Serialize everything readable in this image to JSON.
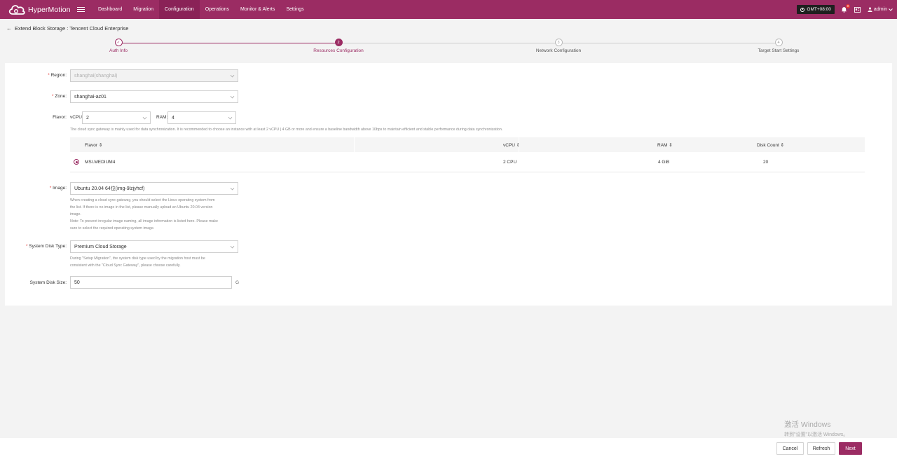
{
  "app": {
    "name": "HyperMotion"
  },
  "nav": {
    "items": [
      {
        "label": "Dashboard"
      },
      {
        "label": "Migration"
      },
      {
        "label": "Configuration"
      },
      {
        "label": "Operations"
      },
      {
        "label": "Monitor & Alerts"
      },
      {
        "label": "Settings"
      }
    ],
    "active": "Configuration",
    "timezone": "GMT+08:00",
    "notification_count": "0",
    "user": "admin"
  },
  "page": {
    "title": "Extend Block Storage : Tencent Cloud Enterprise"
  },
  "steps": [
    {
      "label": "Auth Info",
      "number": "✓",
      "state": "done"
    },
    {
      "label": "Resources Configuration",
      "number": "2",
      "state": "current"
    },
    {
      "label": "Network Configuration",
      "number": "3",
      "state": "pending"
    },
    {
      "label": "Target Start Settings",
      "number": "4",
      "state": "pending"
    }
  ],
  "form": {
    "region": {
      "label": "Region:",
      "value": "shanghai(shanghai)"
    },
    "zone": {
      "label": "Zone:",
      "value": "shanghai-az01"
    },
    "flavor": {
      "label": "Flavor:",
      "vcpu_label": "vCPU:",
      "vcpu_value": "2",
      "ram_label": "RAM:",
      "ram_value": "4",
      "hint": "The cloud sync gateway is mainly used for data synchronization. It is recommended to choose an instance with at least 2 vCPU | 4 GB or more and ensure a baseline bandwidth above 10bps to maintain efficient and stable performance during data synchronization."
    },
    "flavor_table": {
      "columns": [
        "Flavor",
        "vCPU",
        "RAM",
        "Disk Count"
      ],
      "rows": [
        {
          "flavor": "MSI.MEDIUM4",
          "vcpu": "2 CPU",
          "ram": "4 GiB",
          "disk_count": "20"
        }
      ]
    },
    "image": {
      "label": "Image:",
      "value": "Ubuntu 20.04 64位(img-9lzjyhcf)",
      "hint1": "When creating a cloud sync gateway, you should select the Linux operating system from",
      "hint2": "the list. If there is no image in the list, please manually upload an Ubuntu 20.04 version",
      "hint3": "image.",
      "hint4": "Note: To prevent irregular image naming, all image information is listed here. Please make",
      "hint5": "sure to select the required operating system image."
    },
    "system_disk_type": {
      "label": "System Disk Type:",
      "value": "Premium Cloud Storage",
      "hint1": "During \"Setup Migration\", the system disk type used by the migration host must be",
      "hint2": "consistent with the \"Cloud Sync Gateway\", please choose carefully."
    },
    "system_disk_size": {
      "label": "System Disk Size:",
      "value": "50",
      "unit": "G"
    }
  },
  "footer": {
    "cancel": "Cancel",
    "refresh": "Refresh",
    "next": "Next"
  },
  "watermark": {
    "line1": "激活 Windows",
    "line2": "转到\"设置\"以激活 Windows。"
  },
  "colors": {
    "brand": "#9b2c63",
    "required": "#e53935"
  }
}
